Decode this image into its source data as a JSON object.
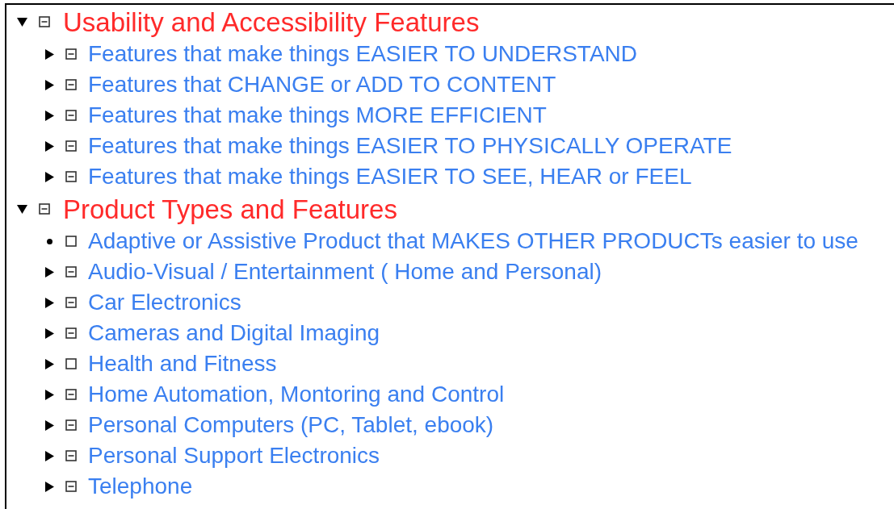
{
  "tree": [
    {
      "label": "Usability and Accessibility Features",
      "kind": "branch",
      "expanded": true,
      "partial": true,
      "children": [
        {
          "label": "Features that make things EASIER TO UNDERSTAND",
          "kind": "branch",
          "expanded": false,
          "partial": true
        },
        {
          "label": "Features that CHANGE or ADD TO CONTENT",
          "kind": "branch",
          "expanded": false,
          "partial": true
        },
        {
          "label": "Features that make things MORE EFFICIENT",
          "kind": "branch",
          "expanded": false,
          "partial": true
        },
        {
          "label": "Features that make things EASIER TO PHYSICALLY OPERATE",
          "kind": "branch",
          "expanded": false,
          "partial": true
        },
        {
          "label": "Features that make things EASIER TO SEE, HEAR or FEEL",
          "kind": "branch",
          "expanded": false,
          "partial": true
        }
      ]
    },
    {
      "label": "Product Types and Features",
      "kind": "branch",
      "expanded": true,
      "partial": true,
      "children": [
        {
          "label": "Adaptive or Assistive Product that MAKES OTHER PRODUCTs easier to use",
          "kind": "leaf",
          "partial": false
        },
        {
          "label": "Audio-Visual / Entertainment ( Home and Personal)",
          "kind": "branch",
          "expanded": false,
          "partial": true
        },
        {
          "label": "Car Electronics",
          "kind": "branch",
          "expanded": false,
          "partial": true
        },
        {
          "label": "Cameras and Digital Imaging",
          "kind": "branch",
          "expanded": false,
          "partial": true
        },
        {
          "label": "Health and Fitness",
          "kind": "branch",
          "expanded": false,
          "partial": false
        },
        {
          "label": "Home Automation, Montoring and Control",
          "kind": "branch",
          "expanded": false,
          "partial": true
        },
        {
          "label": "Personal Computers (PC, Tablet, ebook)",
          "kind": "branch",
          "expanded": false,
          "partial": true
        },
        {
          "label": "Personal Support Electronics",
          "kind": "branch",
          "expanded": false,
          "partial": true
        },
        {
          "label": "Telephone",
          "kind": "branch",
          "expanded": false,
          "partial": true
        }
      ]
    }
  ]
}
